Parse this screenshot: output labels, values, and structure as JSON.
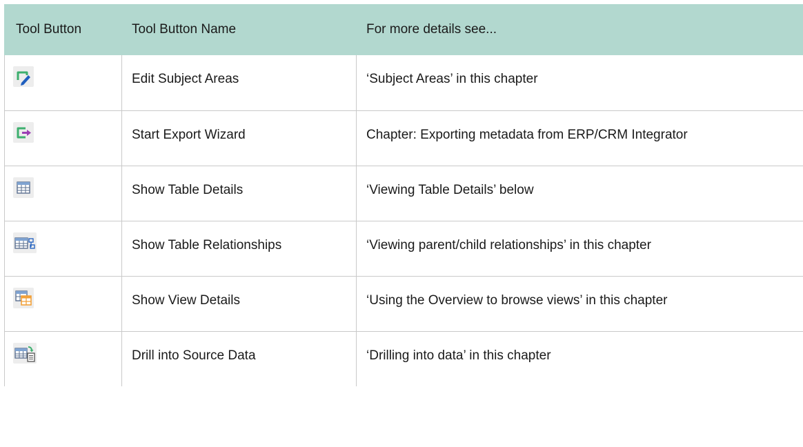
{
  "table": {
    "headers": [
      "Tool Button",
      "Tool Button Name",
      "For more details see..."
    ],
    "rows": [
      {
        "icon": "edit-subject-areas-icon",
        "name": "Edit Subject Areas",
        "details": "‘Subject Areas’ in this chapter"
      },
      {
        "icon": "start-export-wizard-icon",
        "name": "Start Export Wizard",
        "details": "Chapter: Exporting metadata from ERP/CRM Integrator"
      },
      {
        "icon": "show-table-details-icon",
        "name": "Show Table Details",
        "details": "‘Viewing Table Details’ below"
      },
      {
        "icon": "show-table-relationships-icon",
        "name": "Show Table Relationships",
        "details": "‘Viewing parent/child relationships’ in this chapter"
      },
      {
        "icon": "show-view-details-icon",
        "name": "Show View Details",
        "details": "‘Using the Overview to browse views’ in this chapter"
      },
      {
        "icon": "drill-into-source-data-icon",
        "name": "Drill into Source Data",
        "details": "‘Drilling into data’ in this chapter"
      }
    ]
  },
  "colors": {
    "header_bg": "#b2d8cf",
    "border": "#c9c9c9",
    "icon_green": "#3daf6e",
    "icon_blue": "#1f5fbf",
    "icon_purple": "#9b3fb5",
    "icon_orange": "#f2a13a"
  }
}
